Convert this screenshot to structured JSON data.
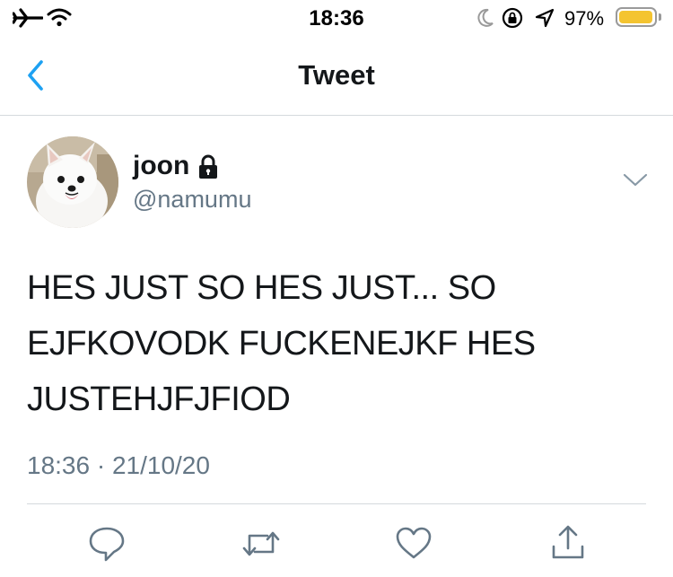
{
  "status_bar": {
    "time": "18:36",
    "battery_percent_label": "97%",
    "battery_level": 0.97,
    "icons": [
      "airplane-icon",
      "wifi-icon",
      "moon-icon",
      "orientation-lock-icon",
      "location-icon",
      "battery-icon"
    ]
  },
  "nav": {
    "title": "Tweet",
    "back_icon": "chevron-left-icon"
  },
  "tweet": {
    "author_name": "joon",
    "handle": "@namumu",
    "text_lines": [
      "HES JUST SO HES JUST... SO",
      "EJFKOVODK FUCKENEJKF HES",
      "JUSTEHJFJFIOD"
    ],
    "timestamp": "18:36 · 21/10/20"
  },
  "actions": [
    "reply-icon",
    "retweet-icon",
    "like-icon",
    "share-icon"
  ],
  "colors": {
    "accent": "#1da1f2",
    "text": "#14171a",
    "secondary": "#657786",
    "divider": "#d4d9dd",
    "battery": "#f4c430"
  }
}
